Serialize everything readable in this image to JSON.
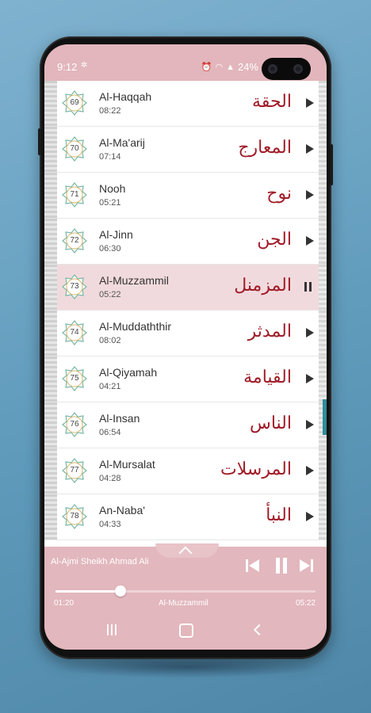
{
  "status_bar": {
    "time": "9:12",
    "battery": "24%"
  },
  "surahs": [
    {
      "number": "69",
      "name": "Al-Haqqah",
      "duration": "08:22",
      "arabic": "الحقة",
      "state": "play"
    },
    {
      "number": "70",
      "name": "Al-Ma'arij",
      "duration": "07:14",
      "arabic": "المعارج",
      "state": "play"
    },
    {
      "number": "71",
      "name": "Nooh",
      "duration": "05:21",
      "arabic": "نوح",
      "state": "play"
    },
    {
      "number": "72",
      "name": "Al-Jinn",
      "duration": "06:30",
      "arabic": "الجن",
      "state": "play"
    },
    {
      "number": "73",
      "name": "Al-Muzzammil",
      "duration": "05:22",
      "arabic": "المزمنل",
      "state": "pause"
    },
    {
      "number": "74",
      "name": "Al-Muddaththir",
      "duration": "08:02",
      "arabic": "المدثر",
      "state": "play"
    },
    {
      "number": "75",
      "name": "Al-Qiyamah",
      "duration": "04:21",
      "arabic": "القيامة",
      "state": "play"
    },
    {
      "number": "76",
      "name": "Al-Insan",
      "duration": "06:54",
      "arabic": "الناس",
      "state": "play"
    },
    {
      "number": "77",
      "name": "Al-Mursalat",
      "duration": "04:28",
      "arabic": "المرسلات",
      "state": "play"
    },
    {
      "number": "78",
      "name": "An-Naba'",
      "duration": "04:33",
      "arabic": "النبأ",
      "state": "play"
    }
  ],
  "player": {
    "reciter": "Al-Ajmi Sheikh Ahmad Ali",
    "current_time": "01:20",
    "track_name": "Al-Muzzammil",
    "total_time": "05:22",
    "progress": 0.25
  },
  "icons": {
    "expand": "chevron-up-icon",
    "previous": "skip-previous-icon",
    "pause": "pause-icon",
    "next": "skip-next-icon",
    "row_play": "play-icon",
    "row_pause": "pause-icon"
  },
  "colors": {
    "accent_pink": "#e2b6bc",
    "active_row": "#f1dadd",
    "arabic_text": "#a01c28",
    "scroll_indicator": "#2e8e9a"
  }
}
